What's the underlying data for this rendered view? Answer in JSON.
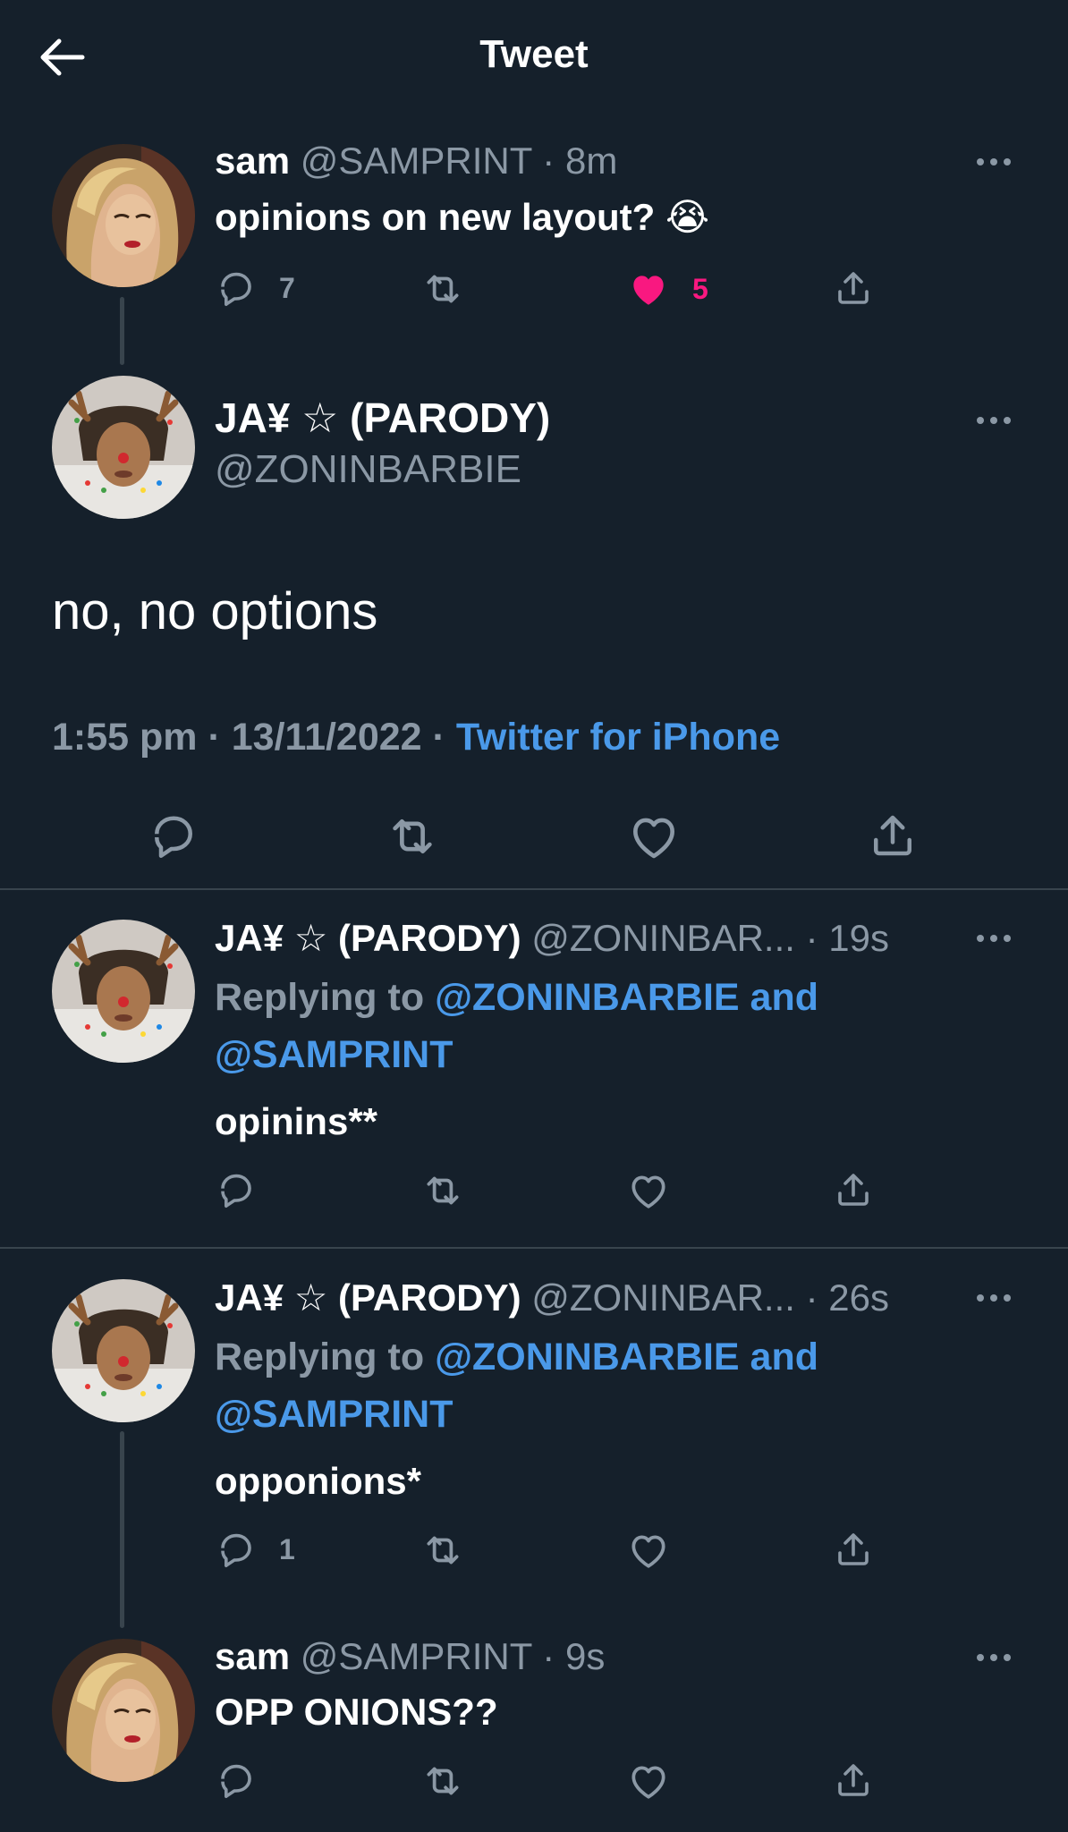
{
  "header": {
    "title": "Tweet",
    "back_icon": "arrow-left-icon"
  },
  "colors": {
    "background": "#15202b",
    "muted": "#8b98a5",
    "link": "#4a99e9",
    "like": "#f91880",
    "divider": "#38444d"
  },
  "parent_tweet": {
    "name": "sam",
    "handle": "@SAMPRINT",
    "separator": "·",
    "time": "8m",
    "text": "opinions on new layout? 😭",
    "reply_count": "7",
    "like_count": "5",
    "liked": true
  },
  "main_tweet": {
    "name": "JA¥ ☆ (PARODY)",
    "handle": "@ZONINBARBIE",
    "text": "no, no options",
    "time": "1:55 pm",
    "separator": "·",
    "date": "13/11/2022",
    "source": "Twitter for iPhone"
  },
  "replies": [
    {
      "name": "JA¥ ☆ (PARODY)",
      "handle": "@ZONINBAR...",
      "separator": "·",
      "time": "19s",
      "replying_prefix": "Replying to",
      "replying_mention1": "@ZONINBARBIE and",
      "replying_mention2": "@SAMPRINT",
      "text": "opinins**",
      "reply_count": ""
    },
    {
      "name": "JA¥ ☆ (PARODY)",
      "handle": "@ZONINBAR...",
      "separator": "·",
      "time": "26s",
      "replying_prefix": "Replying to",
      "replying_mention1": "@ZONINBARBIE and",
      "replying_mention2": "@SAMPRINT",
      "text": "opponions*",
      "reply_count": "1"
    },
    {
      "name": "sam",
      "handle": "@SAMPRINT",
      "separator": "·",
      "time": "9s",
      "text": "OPP ONIONS??",
      "reply_count": ""
    }
  ]
}
